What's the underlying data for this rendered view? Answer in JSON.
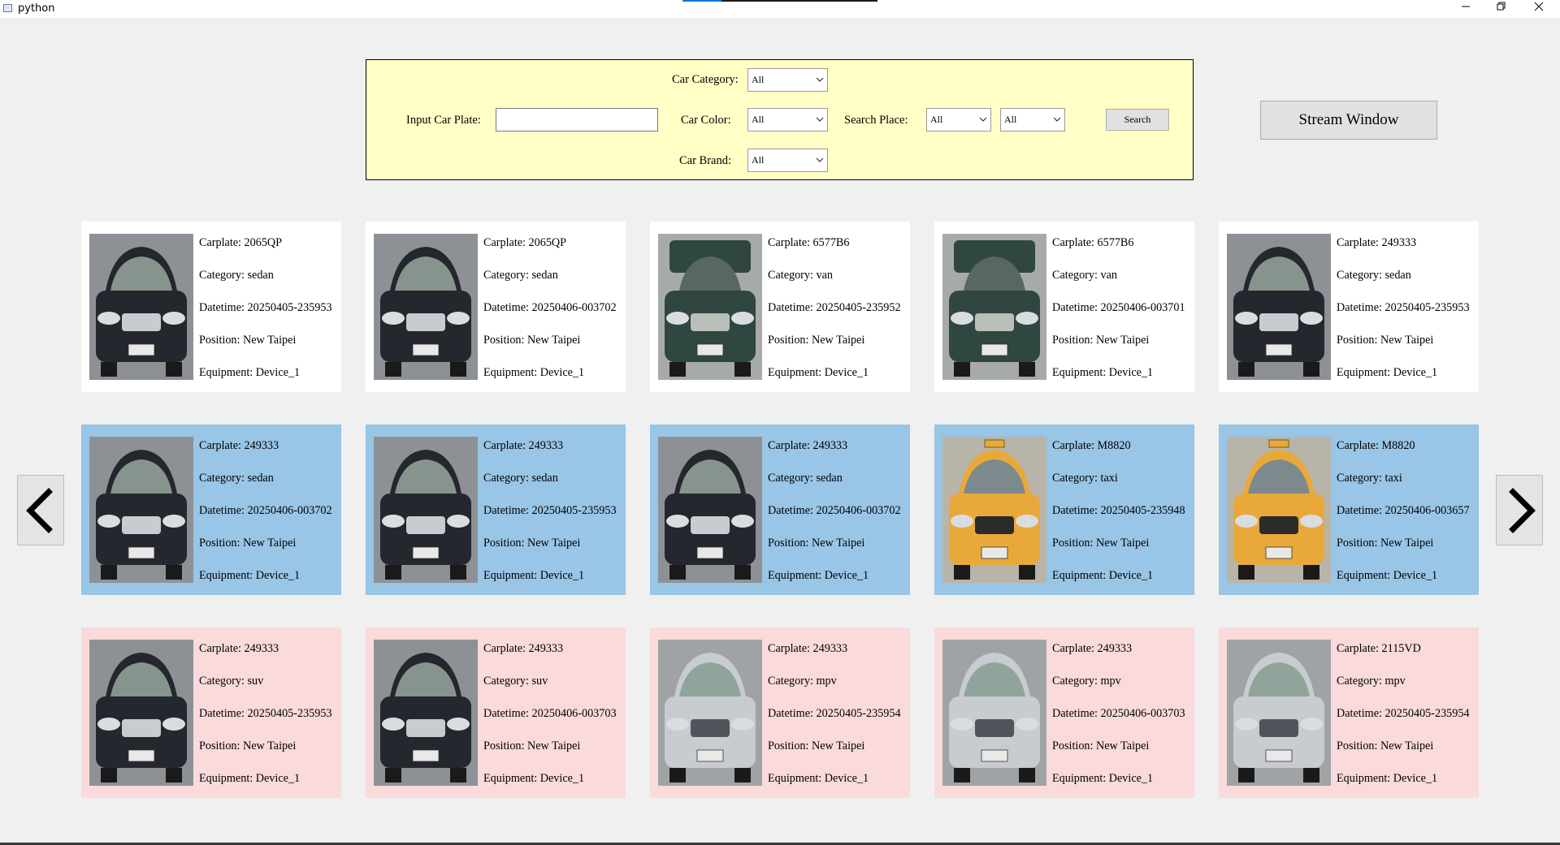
{
  "window": {
    "title": "python",
    "minimize_icon": "minimize-icon",
    "restore_icon": "restore-icon",
    "close_icon": "close-icon"
  },
  "search": {
    "car_category_label": "Car Category:",
    "car_category_value": "All",
    "plate_label": "Input Car Plate:",
    "plate_value": "",
    "car_color_label": "Car Color:",
    "car_color_value": "All",
    "search_place_label": "Search Place:",
    "search_place_value_1": "All",
    "search_place_value_2": "All",
    "car_brand_label": "Car Brand:",
    "car_brand_value": "All",
    "search_button": "Search"
  },
  "stream_button": "Stream Window",
  "colors": {
    "panel_bg": "#ffffc6",
    "card_white": "#ffffff",
    "card_blue": "#99c5e6",
    "card_pink": "#fadadb"
  },
  "labels": {
    "carplate": "Carplate: ",
    "category": "Category: ",
    "datetime": "Datetime: ",
    "position": "Position: ",
    "equipment": "Equipment: "
  },
  "cards": [
    {
      "row": 0,
      "col": 0,
      "style": "white",
      "car": "dark-sedan",
      "plate": "2065QP",
      "category": "sedan",
      "datetime": "20250405-235953",
      "position": "New Taipei",
      "equipment": "Device_1"
    },
    {
      "row": 0,
      "col": 1,
      "style": "white",
      "car": "dark-sedan",
      "plate": "2065QP",
      "category": "sedan",
      "datetime": "20250406-003702",
      "position": "New Taipei",
      "equipment": "Device_1"
    },
    {
      "row": 0,
      "col": 2,
      "style": "white",
      "car": "green-van",
      "plate": "6577B6",
      "category": "van",
      "datetime": "20250405-235952",
      "position": "New Taipei",
      "equipment": "Device_1"
    },
    {
      "row": 0,
      "col": 3,
      "style": "white",
      "car": "green-van",
      "plate": "6577B6",
      "category": "van",
      "datetime": "20250406-003701",
      "position": "New Taipei",
      "equipment": "Device_1"
    },
    {
      "row": 0,
      "col": 4,
      "style": "white",
      "car": "dark-sedan",
      "plate": "249333",
      "category": "sedan",
      "datetime": "20250405-235953",
      "position": "New Taipei",
      "equipment": "Device_1"
    },
    {
      "row": 1,
      "col": 0,
      "style": "blue",
      "car": "dark-sedan",
      "plate": "249333",
      "category": "sedan",
      "datetime": "20250406-003702",
      "position": "New Taipei",
      "equipment": "Device_1"
    },
    {
      "row": 1,
      "col": 1,
      "style": "blue",
      "car": "dark-sedan",
      "plate": "249333",
      "category": "sedan",
      "datetime": "20250405-235953",
      "position": "New Taipei",
      "equipment": "Device_1"
    },
    {
      "row": 1,
      "col": 2,
      "style": "blue",
      "car": "dark-sedan",
      "plate": "249333",
      "category": "sedan",
      "datetime": "20250406-003702",
      "position": "New Taipei",
      "equipment": "Device_1"
    },
    {
      "row": 1,
      "col": 3,
      "style": "blue",
      "car": "yellow-taxi",
      "plate": "M8820",
      "category": "taxi",
      "datetime": "20250405-235948",
      "position": "New Taipei",
      "equipment": "Device_1"
    },
    {
      "row": 1,
      "col": 4,
      "style": "blue",
      "car": "yellow-taxi",
      "plate": "M8820",
      "category": "taxi",
      "datetime": "20250406-003657",
      "position": "New Taipei",
      "equipment": "Device_1"
    },
    {
      "row": 2,
      "col": 0,
      "style": "pink",
      "car": "dark-sedan",
      "plate": "249333",
      "category": "suv",
      "datetime": "20250405-235953",
      "position": "New Taipei",
      "equipment": "Device_1"
    },
    {
      "row": 2,
      "col": 1,
      "style": "pink",
      "car": "dark-sedan",
      "plate": "249333",
      "category": "suv",
      "datetime": "20250406-003703",
      "position": "New Taipei",
      "equipment": "Device_1"
    },
    {
      "row": 2,
      "col": 2,
      "style": "pink",
      "car": "silver-mpv",
      "plate": "249333",
      "category": "mpv",
      "datetime": "20250405-235954",
      "position": "New Taipei",
      "equipment": "Device_1"
    },
    {
      "row": 2,
      "col": 3,
      "style": "pink",
      "car": "silver-mpv",
      "plate": "249333",
      "category": "mpv",
      "datetime": "20250406-003703",
      "position": "New Taipei",
      "equipment": "Device_1"
    },
    {
      "row": 2,
      "col": 4,
      "style": "pink",
      "car": "silver-mpv",
      "plate": "2115VD",
      "category": "mpv",
      "datetime": "20250405-235954",
      "position": "New Taipei",
      "equipment": "Device_1"
    }
  ],
  "nav": {
    "prev_icon": "chevron-left-icon",
    "next_icon": "chevron-right-icon"
  }
}
